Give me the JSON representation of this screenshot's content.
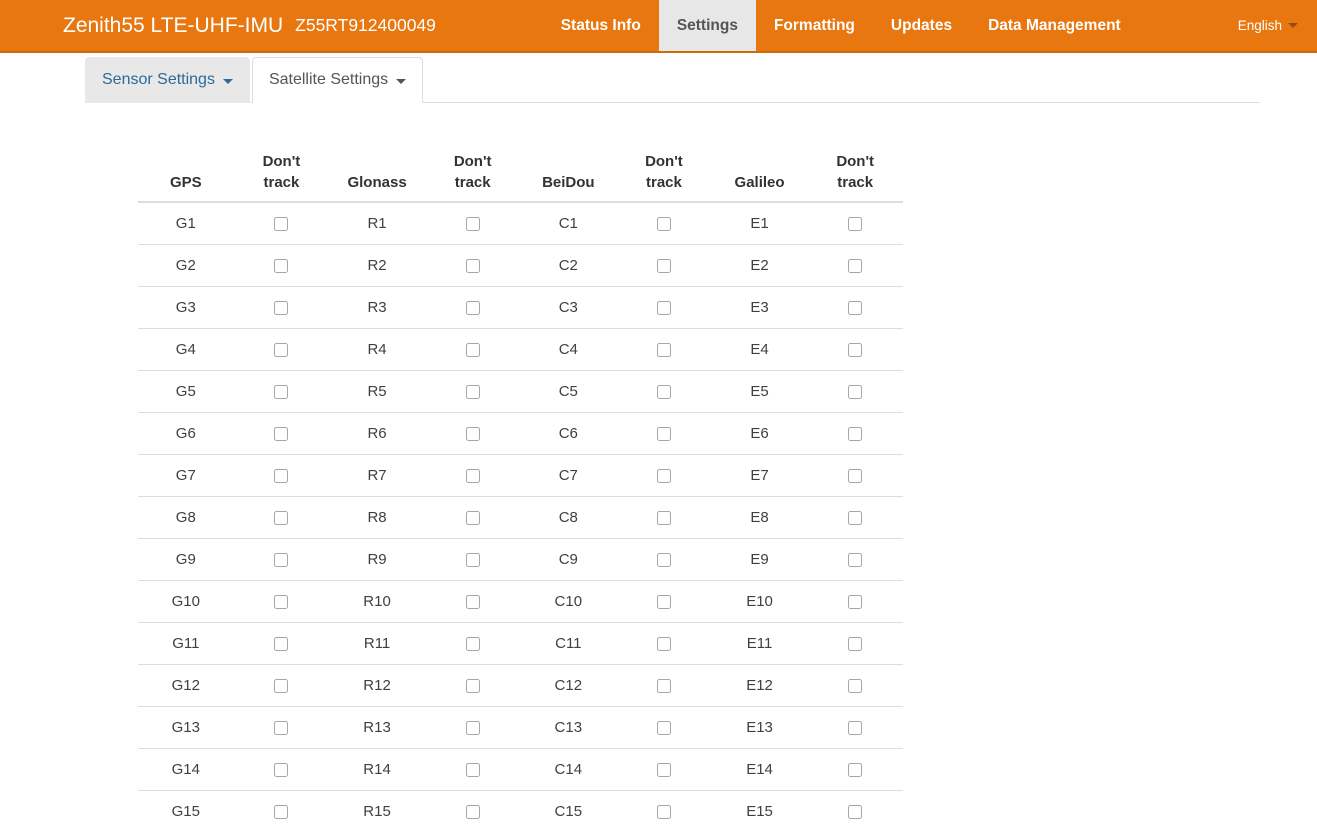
{
  "header": {
    "title": "Zenith55 LTE-UHF-IMU",
    "serial": "Z55RT912400049",
    "nav_items": [
      {
        "label": "Status Info",
        "active": false
      },
      {
        "label": "Settings",
        "active": true
      },
      {
        "label": "Formatting",
        "active": false
      },
      {
        "label": "Updates",
        "active": false
      },
      {
        "label": "Data Management",
        "active": false
      }
    ],
    "language": "English"
  },
  "tabs": [
    {
      "label": "Sensor Settings",
      "active": false,
      "dropdown": true
    },
    {
      "label": "Satellite Settings",
      "active": true,
      "dropdown": true
    }
  ],
  "satellite_table": {
    "columns": [
      "GPS",
      "Don't track",
      "Glonass",
      "Don't track",
      "BeiDou",
      "Don't track",
      "Galileo",
      "Don't track"
    ],
    "rows": [
      {
        "gps": "G1",
        "gps_dont_track": false,
        "glonass": "R1",
        "glonass_dont_track": false,
        "beidou": "C1",
        "beidou_dont_track": false,
        "galileo": "E1",
        "galileo_dont_track": false
      },
      {
        "gps": "G2",
        "gps_dont_track": false,
        "glonass": "R2",
        "glonass_dont_track": false,
        "beidou": "C2",
        "beidou_dont_track": false,
        "galileo": "E2",
        "galileo_dont_track": false
      },
      {
        "gps": "G3",
        "gps_dont_track": false,
        "glonass": "R3",
        "glonass_dont_track": false,
        "beidou": "C3",
        "beidou_dont_track": false,
        "galileo": "E3",
        "galileo_dont_track": false
      },
      {
        "gps": "G4",
        "gps_dont_track": false,
        "glonass": "R4",
        "glonass_dont_track": false,
        "beidou": "C4",
        "beidou_dont_track": false,
        "galileo": "E4",
        "galileo_dont_track": false
      },
      {
        "gps": "G5",
        "gps_dont_track": false,
        "glonass": "R5",
        "glonass_dont_track": false,
        "beidou": "C5",
        "beidou_dont_track": false,
        "galileo": "E5",
        "galileo_dont_track": false
      },
      {
        "gps": "G6",
        "gps_dont_track": false,
        "glonass": "R6",
        "glonass_dont_track": false,
        "beidou": "C6",
        "beidou_dont_track": false,
        "galileo": "E6",
        "galileo_dont_track": false
      },
      {
        "gps": "G7",
        "gps_dont_track": false,
        "glonass": "R7",
        "glonass_dont_track": false,
        "beidou": "C7",
        "beidou_dont_track": false,
        "galileo": "E7",
        "galileo_dont_track": false
      },
      {
        "gps": "G8",
        "gps_dont_track": false,
        "glonass": "R8",
        "glonass_dont_track": false,
        "beidou": "C8",
        "beidou_dont_track": false,
        "galileo": "E8",
        "galileo_dont_track": false
      },
      {
        "gps": "G9",
        "gps_dont_track": false,
        "glonass": "R9",
        "glonass_dont_track": false,
        "beidou": "C9",
        "beidou_dont_track": false,
        "galileo": "E9",
        "galileo_dont_track": false
      },
      {
        "gps": "G10",
        "gps_dont_track": false,
        "glonass": "R10",
        "glonass_dont_track": false,
        "beidou": "C10",
        "beidou_dont_track": false,
        "galileo": "E10",
        "galileo_dont_track": false
      },
      {
        "gps": "G11",
        "gps_dont_track": false,
        "glonass": "R11",
        "glonass_dont_track": false,
        "beidou": "C11",
        "beidou_dont_track": false,
        "galileo": "E11",
        "galileo_dont_track": false
      },
      {
        "gps": "G12",
        "gps_dont_track": false,
        "glonass": "R12",
        "glonass_dont_track": false,
        "beidou": "C12",
        "beidou_dont_track": false,
        "galileo": "E12",
        "galileo_dont_track": false
      },
      {
        "gps": "G13",
        "gps_dont_track": false,
        "glonass": "R13",
        "glonass_dont_track": false,
        "beidou": "C13",
        "beidou_dont_track": false,
        "galileo": "E13",
        "galileo_dont_track": false
      },
      {
        "gps": "G14",
        "gps_dont_track": false,
        "glonass": "R14",
        "glonass_dont_track": false,
        "beidou": "C14",
        "beidou_dont_track": false,
        "galileo": "E14",
        "galileo_dont_track": false
      },
      {
        "gps": "G15",
        "gps_dont_track": false,
        "glonass": "R15",
        "glonass_dont_track": false,
        "beidou": "C15",
        "beidou_dont_track": false,
        "galileo": "E15",
        "galileo_dont_track": false
      }
    ]
  },
  "colors": {
    "navbar_orange": "#e8770f",
    "navbar_border": "#d06a06",
    "active_nav_bg": "#e7e7e7",
    "active_nav_text": "#555555",
    "tab_link_blue": "#2b6a99",
    "table_border": "#dddddd"
  }
}
